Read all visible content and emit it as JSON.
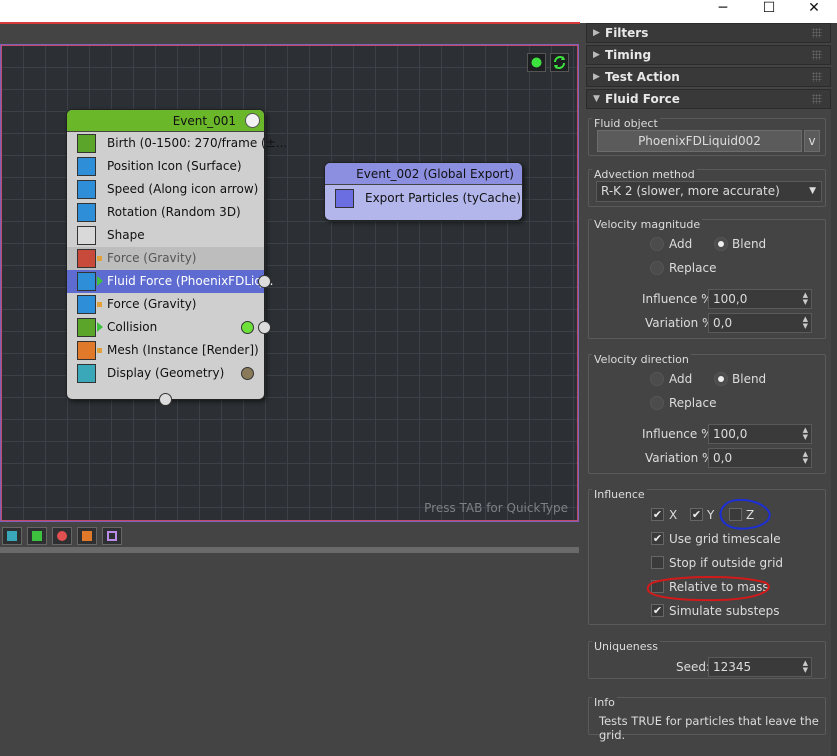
{
  "window": {
    "minimize": "─",
    "maximize": "☐",
    "close": "✕"
  },
  "graph": {
    "hint": "Press TAB for QuickType",
    "events": [
      {
        "title": "Event_001",
        "header_color": "#6ab72a",
        "operators": [
          {
            "label": "Birth (0-1500: 270/frame (±...",
            "icon": "birth-icon",
            "icon_color": "#5aa52a",
            "state": "normal"
          },
          {
            "label": "Position Icon (Surface)",
            "icon": "position-icon",
            "icon_color": "#2e8fd8",
            "state": "normal"
          },
          {
            "label": "Speed (Along icon arrow)",
            "icon": "speed-icon",
            "icon_color": "#2e8fd8",
            "state": "normal"
          },
          {
            "label": "Rotation (Random 3D)",
            "icon": "rotation-icon",
            "icon_color": "#2e8fd8",
            "state": "normal"
          },
          {
            "label": "Shape",
            "icon": "shape-icon",
            "icon_color": "#d9d9d9",
            "state": "normal"
          },
          {
            "label": "Force (Gravity)",
            "icon": "force-icon",
            "icon_color": "#c84a3a",
            "state": "disabled"
          },
          {
            "label": "Fluid Force (PhoenixFDLiq...",
            "icon": "fluid-force-icon",
            "icon_color": "#2e8fd8",
            "state": "selected"
          },
          {
            "label": "Force (Gravity)",
            "icon": "force-icon",
            "icon_color": "#2e8fd8",
            "state": "normal"
          },
          {
            "label": "Collision",
            "icon": "collision-icon",
            "icon_color": "#5aa52a",
            "state": "normal"
          },
          {
            "label": "Mesh (Instance [Render])",
            "icon": "mesh-icon",
            "icon_color": "#e07a2a",
            "state": "normal"
          },
          {
            "label": "Display (Geometry)",
            "icon": "display-icon",
            "icon_color": "#3aa8b8",
            "state": "normal"
          }
        ]
      },
      {
        "title": "Event_002 (Global Export)",
        "header_color": "#8c8fe0",
        "operators": [
          {
            "label": "Export Particles (tyCache)",
            "icon": "export-icon",
            "icon_color": "#6a6ee0",
            "state": "normal"
          }
        ]
      }
    ]
  },
  "panel": {
    "rollouts": [
      {
        "label": "Filters",
        "expanded": false
      },
      {
        "label": "Timing",
        "expanded": false
      },
      {
        "label": "Test Action",
        "expanded": false
      },
      {
        "label": "Fluid Force",
        "expanded": true
      }
    ],
    "fluid_object": {
      "title": "Fluid object",
      "button": "PhoenixFDLiquid002",
      "side_button": "v"
    },
    "advection": {
      "title": "Advection method",
      "value": "R-K 2 (slower, more accurate)"
    },
    "velocity_magnitude": {
      "title": "Velocity magnitude",
      "add": "Add",
      "blend": "Blend",
      "replace": "Replace",
      "selected": "Blend",
      "influence_label": "Influence %:",
      "influence_value": "100,0",
      "variation_label": "Variation %:",
      "variation_value": "0,0"
    },
    "velocity_direction": {
      "title": "Velocity direction",
      "add": "Add",
      "blend": "Blend",
      "replace": "Replace",
      "selected": "Blend",
      "influence_label": "Influence %:",
      "influence_value": "100,0",
      "variation_label": "Variation %:",
      "variation_value": "0,0"
    },
    "influence": {
      "title": "Influence",
      "x": {
        "label": "X",
        "checked": true
      },
      "y": {
        "label": "Y",
        "checked": true
      },
      "z": {
        "label": "Z",
        "checked": false
      },
      "use_grid_timescale": {
        "label": "Use grid timescale",
        "checked": true
      },
      "stop_if_outside": {
        "label": "Stop if outside grid",
        "checked": false
      },
      "relative_to_mass": {
        "label": "Relative to mass",
        "checked": false
      },
      "simulate_substeps": {
        "label": "Simulate substeps",
        "checked": true
      }
    },
    "uniqueness": {
      "title": "Uniqueness",
      "seed_label": "Seed:",
      "seed_value": "12345"
    },
    "info": {
      "title": "Info",
      "text": "Tests TRUE for particles that leave the grid."
    }
  },
  "annotations": {
    "blue": "#1c2fd6",
    "red": "#d21a1a"
  }
}
